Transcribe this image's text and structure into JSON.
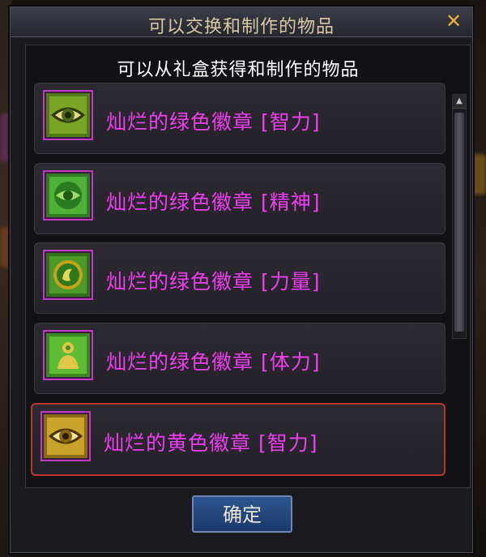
{
  "window": {
    "title": "可以交换和制作的物品",
    "close_symbol": "✕"
  },
  "panel": {
    "subtitle": "可以从礼盒获得和制作的物品"
  },
  "items": [
    {
      "label": "灿烂的绿色徽章 [智力]",
      "icon": "green-eye-emblem-icon",
      "color": "#5a8f1a"
    },
    {
      "label": "灿烂的绿色徽章 [精神]",
      "icon": "green-spirit-emblem-icon",
      "color": "#3f9a2e"
    },
    {
      "label": "灿烂的绿色徽章 [力量]",
      "icon": "green-strength-emblem-icon",
      "color": "#3b8a25"
    },
    {
      "label": "灿烂的绿色徽章 [体力]",
      "icon": "green-stamina-emblem-icon",
      "color": "#4aa12e"
    },
    {
      "label": "灿烂的黄色徽章 [智力]",
      "icon": "yellow-eye-emblem-icon",
      "color": "#b38a12"
    }
  ],
  "confirm_label": "确定",
  "colors": {
    "item_text": "#f33df3",
    "selected_border": "#b8382c",
    "title_text": "#d8c9a4"
  }
}
